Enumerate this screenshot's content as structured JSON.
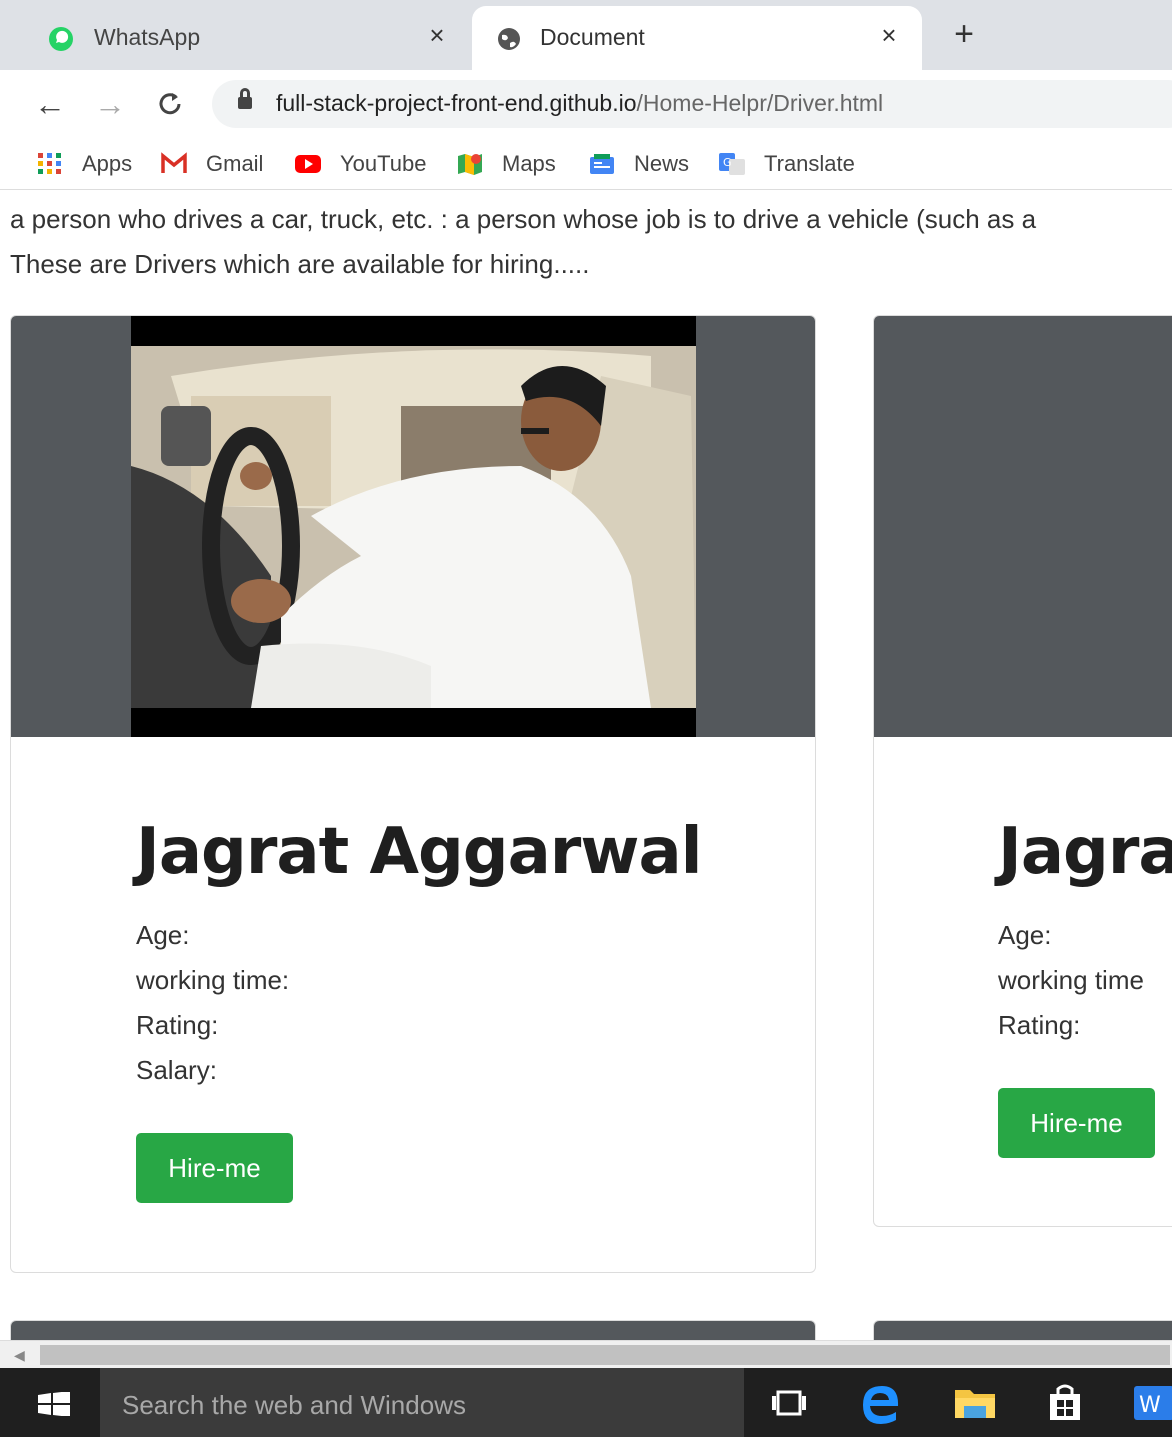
{
  "browser": {
    "tabs": [
      {
        "title": "WhatsApp",
        "active": false,
        "icon": "whatsapp-icon"
      },
      {
        "title": "Document",
        "active": true,
        "icon": "globe-icon"
      }
    ],
    "close_glyph": "×",
    "new_tab_glyph": "+",
    "nav": {
      "back": "←",
      "forward": "→",
      "reload": "C"
    },
    "url": {
      "host": "full-stack-project-front-end.github.io",
      "path": "/Home-Helpr/Driver.html"
    },
    "bookmarks": [
      {
        "label": "Apps",
        "icon": "apps-grid-icon"
      },
      {
        "label": "Gmail",
        "icon": "gmail-icon"
      },
      {
        "label": "YouTube",
        "icon": "youtube-icon"
      },
      {
        "label": "Maps",
        "icon": "maps-icon"
      },
      {
        "label": "News",
        "icon": "news-icon"
      },
      {
        "label": "Translate",
        "icon": "translate-icon"
      }
    ]
  },
  "page": {
    "intro_line1": "a person who drives a car, truck, etc. : a person whose job is to drive a vehicle (such as a",
    "intro_line2": "These are Drivers which are available for hiring.....",
    "cards": [
      {
        "name": "Jagrat Aggarwal",
        "fields": [
          "Age:",
          "working time:",
          "Rating:",
          "Salary:"
        ],
        "button": "Hire-me"
      },
      {
        "name": "Jagra",
        "fields": [
          "Age:",
          "working time",
          "Rating:"
        ],
        "button": "Hire-me"
      }
    ]
  },
  "taskbar": {
    "search_placeholder": "Search the web and Windows"
  },
  "colors": {
    "hire_button": "#28a745",
    "card_image_bg": "#54585c",
    "tabstrip": "#dee1e6",
    "taskbar": "#1f1f1f"
  }
}
